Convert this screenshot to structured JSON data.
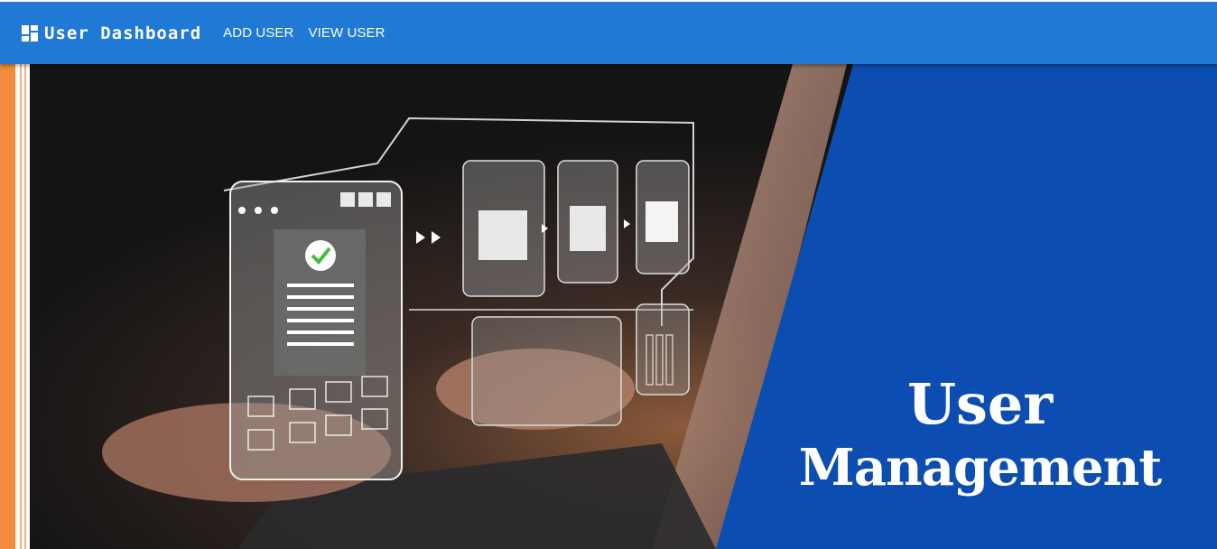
{
  "header": {
    "brand_icon": "dashboard-icon",
    "title": "User Dashboard",
    "nav": [
      {
        "label": "ADD USER"
      },
      {
        "label": "VIEW USER"
      }
    ]
  },
  "hero": {
    "title_line1": "User",
    "title_line2": "Management"
  },
  "colors": {
    "appbar": "#1f79d5",
    "left_strip": "#f28c3c",
    "hero_panel": "#0b4db0"
  }
}
